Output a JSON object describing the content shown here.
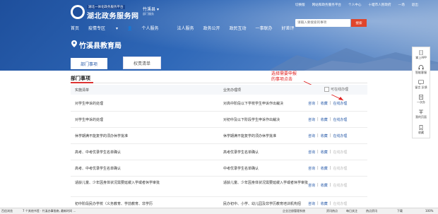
{
  "header": {
    "top_links": [
      "切换版",
      "网站和政务服务平台",
      "个人中心",
      "十堰市人民政府",
      "一场",
      "退出"
    ],
    "brand_top": "湖北一体化政务服务平台",
    "brand": "湖北政务服务网",
    "region": "竹溪县",
    "region_sub": "部门服务",
    "search_placeholder": "请输入要搜索的事项",
    "search_button": "搜索",
    "nav": [
      "首页",
      "疫情专区",
      "个人服务",
      "法人服务",
      "政务公开",
      "政民互动",
      "一事联办",
      "好差评"
    ]
  },
  "bureau": "竹溪县教育局",
  "tabs": [
    "部门事项",
    "权责清单"
  ],
  "section": {
    "title": "部门事项",
    "col1": "实施清单",
    "col2": "业务办理项",
    "col3": "可在线办理"
  },
  "annotation": [
    "选择需要申报",
    "的事项点击"
  ],
  "rows": [
    {
      "name": "对学生申诉的处理",
      "item": "对高中阶段以下学校学生申诉作出裁决",
      "a1": "咨询",
      "a2": "收藏",
      "a3": "在线办理",
      "online": true
    },
    {
      "name": "对学生申诉的处理",
      "item": "对初中及以下阶段学生申诉作出裁决",
      "a1": "咨询",
      "a2": "收藏",
      "a3": "在线办理",
      "online": true
    },
    {
      "name": "休学期满不能复学的须办休学批准",
      "item": "休学期满不能复学的须办休学批准",
      "a1": "咨询",
      "a2": "收藏",
      "a3": "在线办理",
      "online": true
    },
    {
      "name": "高考、中考优录学生名单确认",
      "item": "高考优录学生名单确认",
      "a1": "咨询",
      "a2": "收藏",
      "a3": "在线办理",
      "online": false
    },
    {
      "name": "高考、中考优录学生名单确认",
      "item": "中考优录学生名单确认",
      "a1": "咨询",
      "a2": "收藏",
      "a3": "在线办理",
      "online": false
    },
    {
      "name": "适龄儿童、少年因身体状况需要延缓入学或者休学审批",
      "item": "适龄儿童、少年因身体状况需要延缓入学或者休学审批",
      "a1": "咨询",
      "a2": "收藏",
      "a3": "在线办理",
      "online": false
    },
    {
      "name": "初中阶段民办学校（义务教育、学前教育、非学历",
      "item": "民办初中、小学、幼儿园及非学历教育培训机构招",
      "a1": "咨询",
      "a2": "收藏",
      "a3": "在线办理",
      "online": false
    }
  ],
  "sidebar": [
    "掌上APP",
    "智能客服",
    "留言 反馈",
    "一次办",
    "我的页面",
    "收藏"
  ],
  "statusbar": [
    "百信浏览",
    "7 个其他书签 · 竹溪办事指南, 最新时间 ...",
    "企业注册管理系统",
    "资讯热点",
    "每日关注",
    "热点资讯",
    "下载",
    "100%"
  ]
}
